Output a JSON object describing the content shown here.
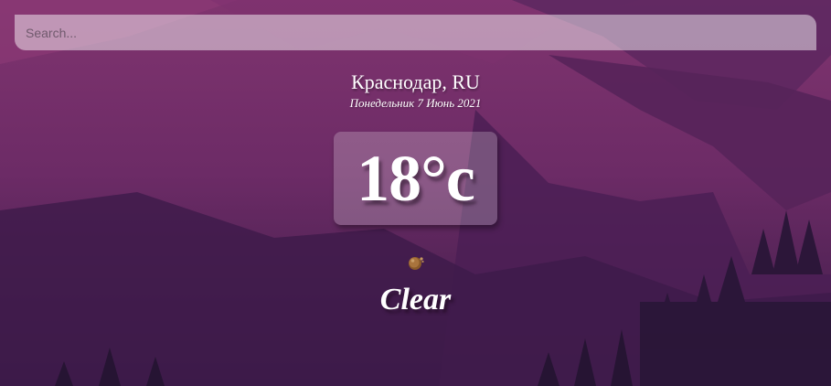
{
  "search": {
    "placeholder": "Search...",
    "value": ""
  },
  "location": {
    "city": "Краснодар, RU",
    "date": "Понедельник 7 Июнь 2021"
  },
  "weather": {
    "temperature": "18°c",
    "condition": "Clear",
    "icon": "weather-status-icon"
  },
  "colors": {
    "background_top": "#7a2f6a",
    "background_bottom": "#2b1838",
    "search_bg": "rgba(255,255,255,0.48)",
    "temp_box_bg": "rgba(255,255,255,0.22)",
    "text": "#ffffff"
  }
}
